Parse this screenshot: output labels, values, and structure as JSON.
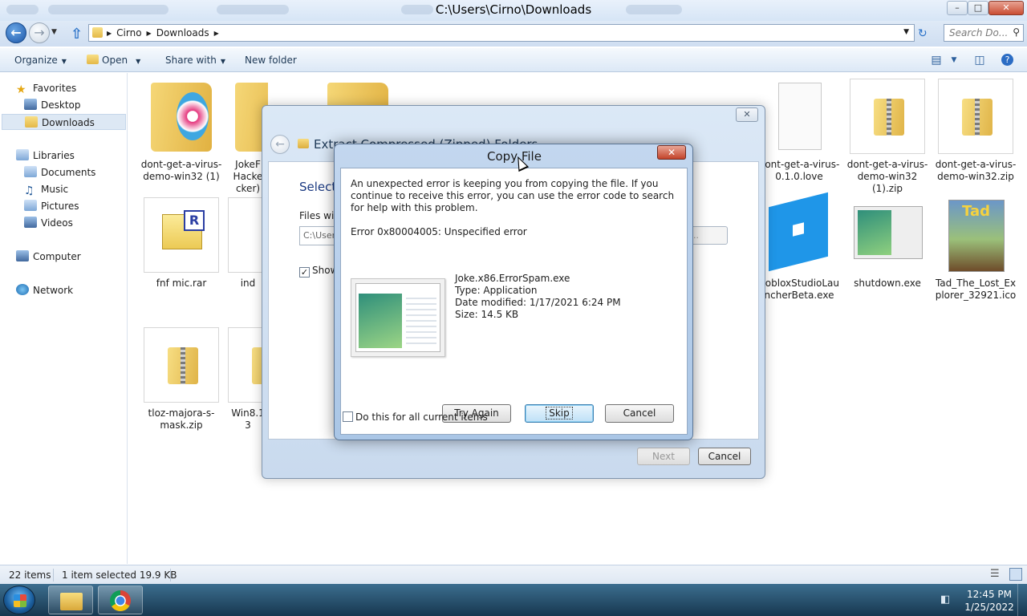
{
  "window": {
    "title": "C:\\Users\\Cirno\\Downloads",
    "minimize_glyph": "–",
    "maximize_glyph": "□",
    "close_glyph": "✕"
  },
  "address": {
    "crumbs": [
      "Cirno",
      "Downloads"
    ],
    "search_placeholder": "Search Do..."
  },
  "commands": {
    "organize": "Organize",
    "open": "Open",
    "share_with": "Share with",
    "new_folder": "New folder"
  },
  "nav": {
    "favorites": "Favorites",
    "desktop": "Desktop",
    "downloads": "Downloads",
    "libraries": "Libraries",
    "documents": "Documents",
    "music": "Music",
    "pictures": "Pictures",
    "videos": "Videos",
    "computer": "Computer",
    "network": "Network"
  },
  "files": [
    {
      "name": "dont-get-a-virus-demo-win32 (1)",
      "icon": "folder-disc-icon"
    },
    {
      "name": "JokeF Hacke cker)",
      "icon": "folder-icon"
    },
    {
      "name": "",
      "icon": "folder-icon"
    },
    {
      "name": "dont-get-a-virus-0.1.0.love",
      "icon": "document-icon"
    },
    {
      "name": "dont-get-a-virus-demo-win32 (1).zip",
      "icon": "zip-icon"
    },
    {
      "name": "dont-get-a-virus-demo-win32.zip",
      "icon": "zip-icon"
    },
    {
      "name": "fnf mic.rar",
      "icon": "rar-icon"
    },
    {
      "name": "ind",
      "icon": "document-icon"
    },
    {
      "name": "RobloxStudioLauncherBeta.exe",
      "icon": "roblox-icon"
    },
    {
      "name": "shutdown.exe",
      "icon": "app-thumbnail-icon"
    },
    {
      "name": "Tad_The_Lost_Explorer_32921.ico",
      "icon": "movie-poster-icon"
    },
    {
      "name": "tloz-majora-s-mask.zip",
      "icon": "zip-icon"
    },
    {
      "name": "Win8.1 3",
      "icon": "zip-icon"
    }
  ],
  "status": {
    "count": "22 items",
    "selection": "1 item selected  19.9 KB"
  },
  "taskbar": {
    "time": "12:45 PM",
    "date": "1/25/2022"
  },
  "extract_dialog": {
    "title": "Extract Compressed (Zipped) Folders",
    "heading": "Select",
    "files_will": "Files will",
    "path_value": "C:\\User",
    "browse": "se...",
    "show_label": "Show",
    "next": "Next",
    "cancel": "Cancel",
    "close_glyph": "✕"
  },
  "copy_dialog": {
    "title": "Copy File",
    "message": "An unexpected error is keeping you from copying the file. If you continue to receive this error, you can use the error code to search for help with this problem.",
    "error": "Error 0x80004005: Unspecified error",
    "file_name": "Joke.x86.ErrorSpam.exe",
    "file_type": "Type: Application",
    "file_modified": "Date modified: 1/17/2021 6:24 PM",
    "file_size": "Size: 14.5 KB",
    "try_again": "Try Again",
    "skip": "Skip",
    "cancel": "Cancel",
    "do_for_all": "Do this for all current items",
    "close_glyph": "✕"
  }
}
